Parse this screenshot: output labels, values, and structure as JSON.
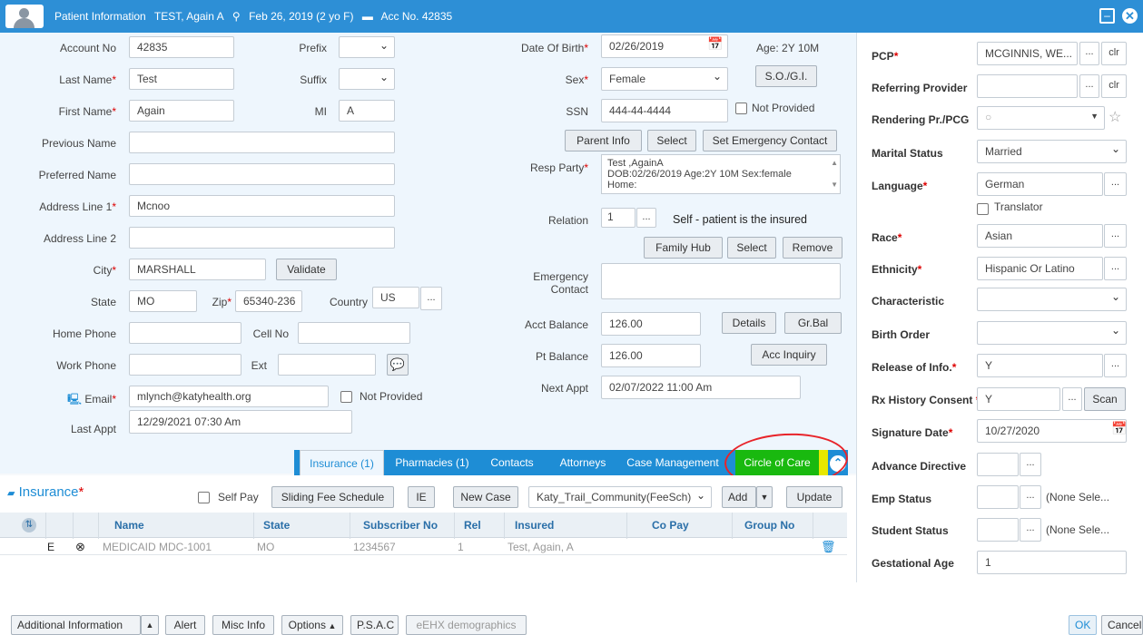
{
  "title": {
    "section": "Patient Information",
    "patient": "TEST, Again A",
    "dob": "Feb 26, 2019 (2 yo F)",
    "acc": "Acc No. 42835"
  },
  "form": {
    "account_no": {
      "label": "Account No",
      "value": "42835"
    },
    "prefix": {
      "label": "Prefix",
      "value": ""
    },
    "last_name": {
      "label": "Last Name",
      "value": "Test"
    },
    "suffix": {
      "label": "Suffix",
      "value": ""
    },
    "first_name": {
      "label": "First Name",
      "value": "Again"
    },
    "mi": {
      "label": "MI",
      "value": "A"
    },
    "previous_name": {
      "label": "Previous Name",
      "value": ""
    },
    "preferred_name": {
      "label": "Preferred Name",
      "value": ""
    },
    "address1": {
      "label": "Address Line 1",
      "value": "Mcnoo"
    },
    "address2": {
      "label": "Address Line 2",
      "value": ""
    },
    "city": {
      "label": "City",
      "value": "MARSHALL"
    },
    "validate": "Validate",
    "state": {
      "label": "State",
      "value": "MO"
    },
    "zip": {
      "label": "Zip",
      "value": "65340-236"
    },
    "country": {
      "label": "Country",
      "value": "US"
    },
    "home_phone": {
      "label": "Home Phone",
      "value": ""
    },
    "cell_no": {
      "label": "Cell No",
      "value": ""
    },
    "work_phone": {
      "label": "Work Phone",
      "value": ""
    },
    "ext": {
      "label": "Ext",
      "value": ""
    },
    "email": {
      "label": "Email",
      "value": "mlynch@katyhealth.org"
    },
    "email_not_provided": "Not Provided",
    "last_appt": {
      "label": "Last Appt",
      "value": "12/29/2021 07:30 Am"
    },
    "dob": {
      "label": "Date Of Birth",
      "value": "02/26/2019"
    },
    "age": "Age: 2Y 10M",
    "sex": {
      "label": "Sex",
      "value": "Female"
    },
    "sogi": "S.O./G.I.",
    "ssn": {
      "label": "SSN",
      "value": "444-44-4444"
    },
    "ssn_not_provided": "Not Provided",
    "parent_info": "Parent Info",
    "select1": "Select",
    "set_emergency": "Set Emergency Contact",
    "resp_party": {
      "label": "Resp Party",
      "line1": "Test ,AgainA",
      "line2": "DOB:02/26/2019 Age:2Y 10M  Sex:female",
      "line3": "Home:"
    },
    "relation": {
      "label": "Relation",
      "value": "1",
      "text": "Self - patient is the insured"
    },
    "family_hub": "Family Hub",
    "select2": "Select",
    "remove": "Remove",
    "emergency": {
      "label1": "Emergency",
      "label2": "Contact",
      "value": ""
    },
    "acct_balance": {
      "label": "Acct Balance",
      "value": "126.00"
    },
    "details": "Details",
    "grbal": "Gr.Bal",
    "pt_balance": {
      "label": "Pt Balance",
      "value": "126.00"
    },
    "acc_inquiry": "Acc Inquiry",
    "next_appt": {
      "label": "Next Appt",
      "value": "02/07/2022 11:00 Am"
    }
  },
  "right": {
    "pcp": {
      "label": "PCP",
      "value": "MCGINNIS, WE..."
    },
    "referring": {
      "label": "Referring Provider",
      "value": ""
    },
    "rendering": {
      "label": "Rendering Pr./PCG",
      "value": ""
    },
    "marital": {
      "label": "Marital Status",
      "value": "Married"
    },
    "language": {
      "label": "Language",
      "value": "German"
    },
    "translator": "Translator",
    "race": {
      "label": "Race",
      "value": "Asian"
    },
    "ethnicity": {
      "label": "Ethnicity",
      "value": "Hispanic Or Latino"
    },
    "characteristic": {
      "label": "Characteristic",
      "value": ""
    },
    "birth_order": {
      "label": "Birth Order",
      "value": ""
    },
    "release": {
      "label": "Release of Info.",
      "value": "Y"
    },
    "rx_history": {
      "label": "Rx History Consent",
      "value": "Y"
    },
    "scan": "Scan",
    "signature_date": {
      "label": "Signature Date",
      "value": "10/27/2020"
    },
    "advance_directive": {
      "label": "Advance Directive",
      "value": ""
    },
    "emp_status": {
      "label": "Emp Status",
      "value": "",
      "note": "(None Sele..."
    },
    "student_status": {
      "label": "Student Status",
      "value": "",
      "note": "(None Sele..."
    },
    "gestational_age": {
      "label": "Gestational Age",
      "value": "1"
    },
    "clr": "clr",
    "dots": "..."
  },
  "tabs": [
    "Insurance (1)",
    "Pharmacies (1)",
    "Contacts",
    "Attorneys",
    "Case Management",
    "Circle of Care"
  ],
  "insurance": {
    "title": "Insurance",
    "self_pay": "Self Pay",
    "sliding_fee": "Sliding Fee Schedule",
    "ie": "IE",
    "new_case": "New Case",
    "fee_schedule": "Katy_Trail_Community(FeeSch)",
    "add": "Add",
    "update": "Update",
    "columns": [
      "Name",
      "State",
      "Subscriber No",
      "Rel",
      "Insured",
      "Co Pay",
      "Group No"
    ],
    "rows": [
      {
        "flag": "E",
        "name": "MEDICAID MDC-1001",
        "state": "MO",
        "subscriber": "1234567",
        "rel": "1",
        "insured": "Test, Again, A",
        "copay": "",
        "group": ""
      }
    ]
  },
  "footer": {
    "additional": "Additional Information",
    "alert": "Alert",
    "misc": "Misc Info",
    "options": "Options",
    "psac": "P.S.A.C",
    "eehx": "eEHX demographics",
    "ok": "OK",
    "cancel": "Cancel"
  },
  "colors": {
    "accent": "#2d8fd6",
    "highlight": "#19b90f",
    "annotation": "#e8242a",
    "required": "#dd0000"
  }
}
